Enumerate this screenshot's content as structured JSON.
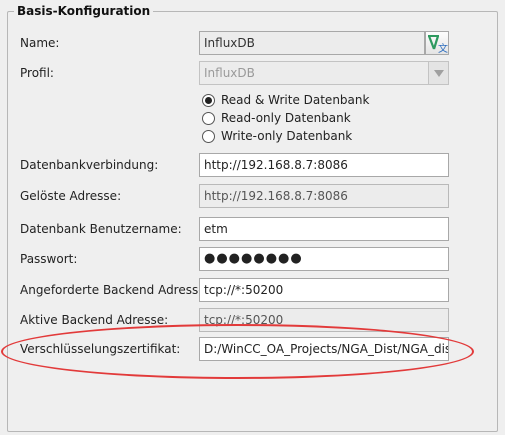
{
  "group": {
    "title": "Basis-Konfiguration"
  },
  "name": {
    "label": "Name:",
    "value": "InfluxDB"
  },
  "profile": {
    "label": "Profil:",
    "selected": "InfluxDB",
    "options": [
      {
        "label": "Read & Write Datenbank",
        "checked": true
      },
      {
        "label": "Read-only Datenbank",
        "checked": false
      },
      {
        "label": "Write-only Datenbank",
        "checked": false
      }
    ]
  },
  "connection": {
    "label": "Datenbankverbindung:",
    "value": "http://192.168.8.7:8086"
  },
  "resolved": {
    "label": "Gelöste Adresse:",
    "value": "http://192.168.8.7:8086"
  },
  "user": {
    "label": "Datenbank Benutzername:",
    "value": "etm"
  },
  "password": {
    "label": "Passwort:",
    "value": "●●●●●●●●"
  },
  "requested_backend": {
    "label": "Angeforderte Backend Adresse:",
    "value": "tcp://*:50200"
  },
  "active_backend": {
    "label": "Aktive Backend Adresse:",
    "value": "tcp://*:50200"
  },
  "certificate": {
    "label": "Verschlüsselungszertifikat:",
    "value": "D:/WinCC_OA_Projects/NGA_Dist/NGA_dist_"
  },
  "colors": {
    "highlight": "#e23a3a",
    "accent_green": "#2e9a5f",
    "accent_blue": "#2f6fbf"
  }
}
